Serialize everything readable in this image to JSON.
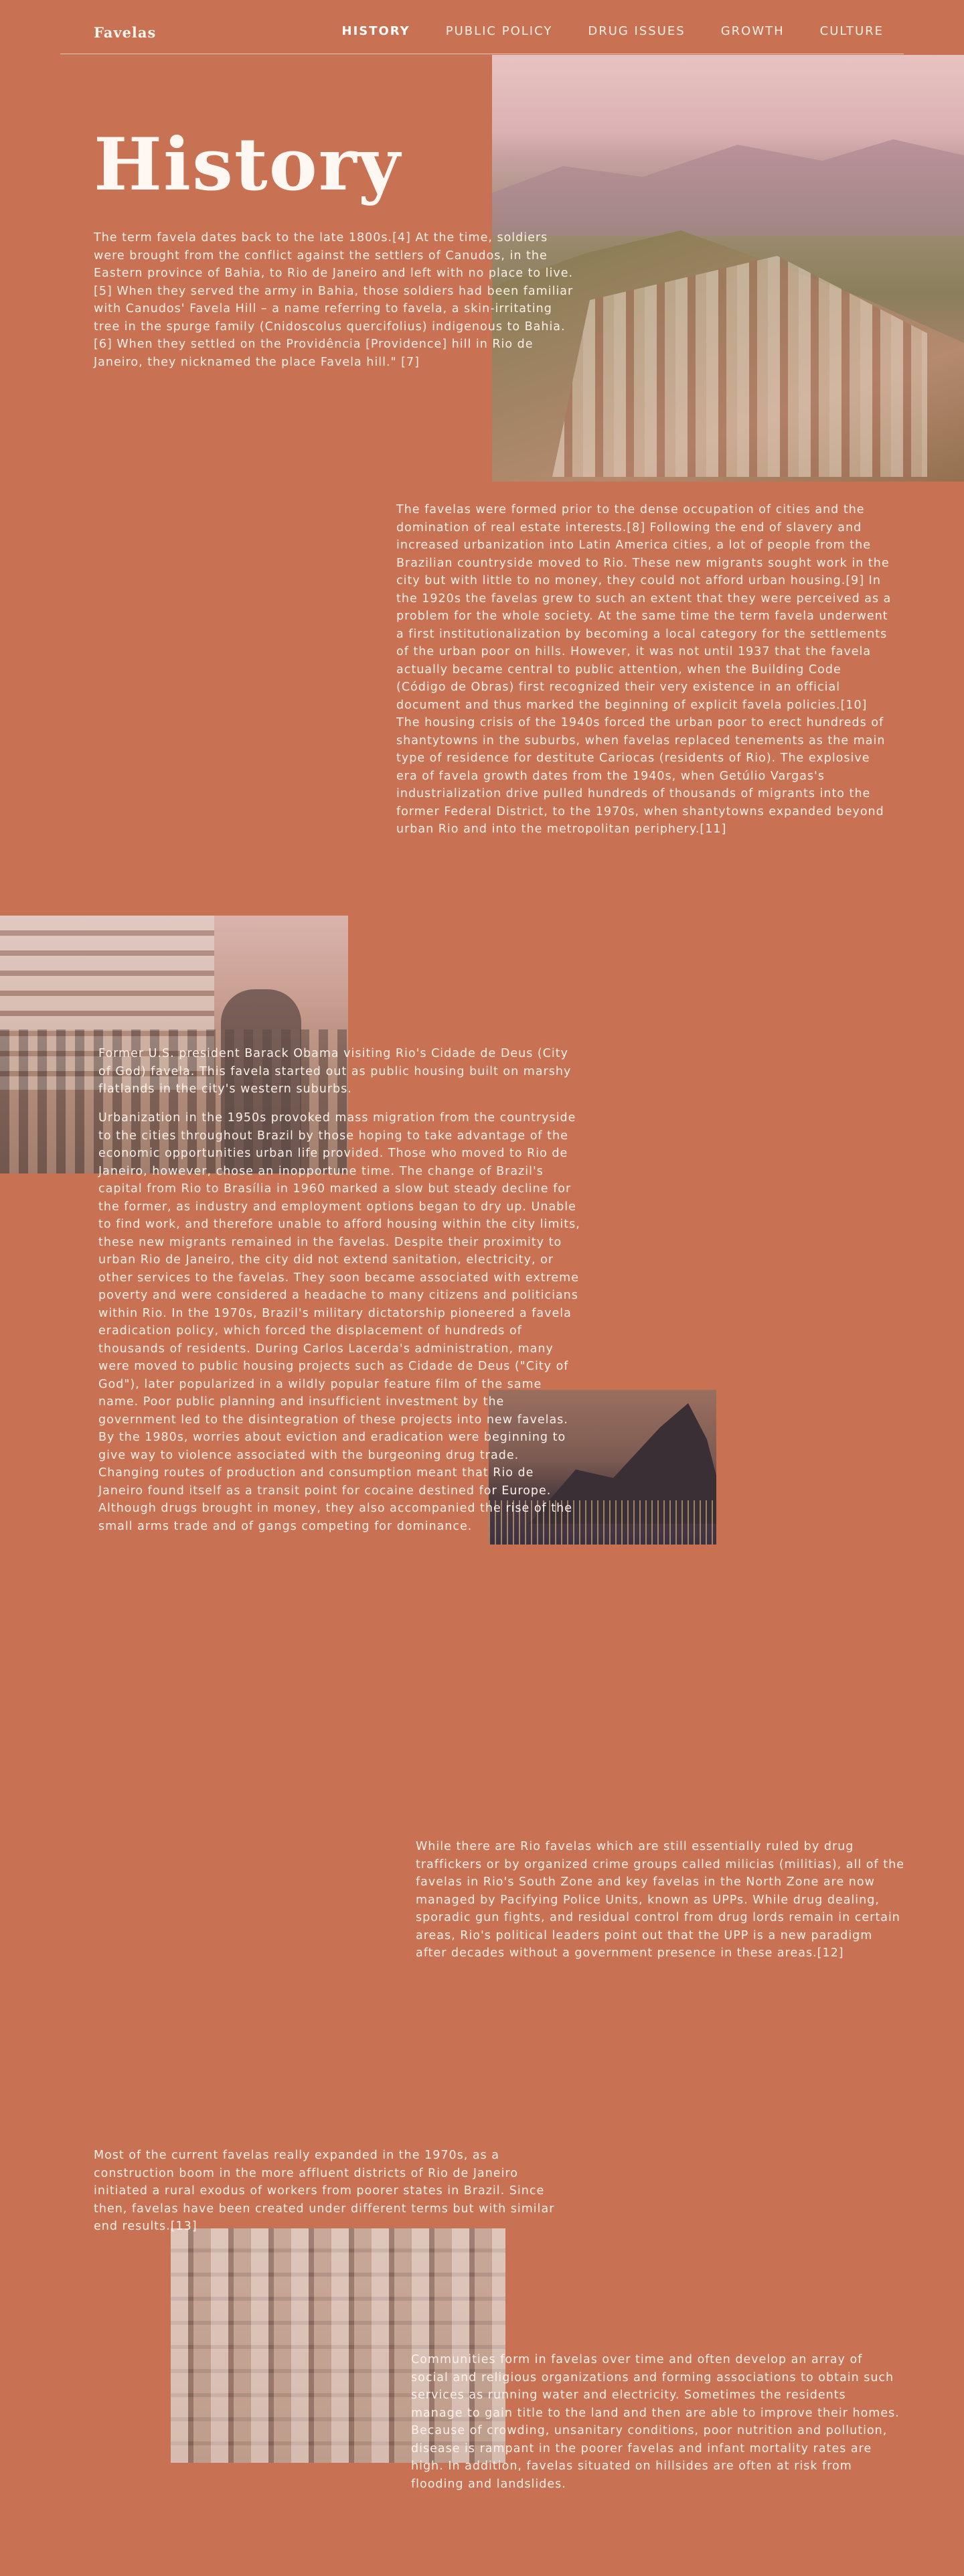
{
  "nav": {
    "brand": "Favelas",
    "links": [
      "HISTORY",
      "PUBLIC POLICY",
      "DRUG ISSUES",
      "GROWTH",
      "CULTURE"
    ],
    "active": "HISTORY"
  },
  "page": {
    "title": "History"
  },
  "content": {
    "p1": "The term favela dates back to the late 1800s.[4] At the time, soldiers were brought from the conflict against the settlers of Canudos, in the Eastern province of Bahia, to Rio de Janeiro and left with no place to live.[5] When they served the army in Bahia, those soldiers had been familiar with Canudos' Favela Hill – a name referring to favela, a skin-irritating tree in the spurge family (Cnidoscolus quercifolius) indigenous to Bahia.[6] When they settled on the Providência [Providence] hill in Rio de Janeiro, they nicknamed the place Favela hill.\" [7]",
    "p2": "The favelas were formed prior to the dense occupation of cities and the domination of real estate interests.[8] Following the end of slavery and increased urbanization into Latin America cities, a lot of people from the Brazilian countryside moved to Rio. These new migrants sought work in the city but with little to no money, they could not afford urban housing.[9] In the 1920s the favelas grew to such an extent that they were perceived as a problem for the whole society. At the same time the term favela underwent a first institutionalization by becoming a local category for the settlements of the urban poor on hills. However, it was not until 1937 that the favela actually became central to public attention, when the Building Code (Código de Obras) first recognized their very existence in an official document and thus marked the beginning of explicit favela policies.[10] The housing crisis of the 1940s forced the urban poor to erect hundreds of shantytowns in the suburbs, when favelas replaced tenements as the main type of residence for destitute Cariocas (residents of Rio). The explosive era of favela growth dates from the 1940s, when Getúlio Vargas's industrialization drive pulled hundreds of thousands of migrants into the former Federal District, to the 1970s, when shantytowns expanded beyond urban Rio and into the metropolitan periphery.[11]",
    "caption": "Former U.S. president Barack Obama visiting Rio's Cidade de Deus (City of God) favela. This favela started out as public housing built on marshy flatlands in the city's western suburbs.",
    "p3": "Urbanization in the 1950s provoked mass migration from the countryside to the cities throughout Brazil by those hoping to take advantage of the economic opportunities urban life provided. Those who moved to Rio de Janeiro, however, chose an inopportune time. The change of Brazil's capital from Rio to Brasília in 1960 marked a slow but steady decline for the former, as industry and employment options began to dry up. Unable to find work, and therefore unable to afford housing within the city limits, these new migrants remained in the favelas. Despite their proximity to urban Rio de Janeiro, the city did not extend sanitation, electricity, or other services to the favelas. They soon became associated with extreme poverty and were considered a headache to many citizens and politicians within Rio. In the 1970s, Brazil's military dictatorship pioneered a favela eradication policy, which forced the displacement of hundreds of thousands of residents. During Carlos Lacerda's administration, many were moved to public housing projects such as Cidade de Deus (\"City of God\"), later popularized in a wildly popular feature film of the same name. Poor public planning and insufficient investment by the government led to the disintegration of these projects into new favelas. By the 1980s, worries about eviction and eradication were beginning to give way to violence associated with the burgeoning drug trade. Changing routes of production and consumption meant that Rio de Janeiro found itself as a transit point for cocaine destined for Europe. Although drugs brought in money, they also accompanied the rise of the small arms trade and of gangs competing for dominance.",
    "p4": "While there are Rio favelas which are still essentially ruled by drug traffickers or by organized crime groups called milicias (militias), all of the favelas in Rio's South Zone and key favelas in the North Zone are now managed by Pacifying Police Units, known as UPPs. While drug dealing, sporadic gun fights, and residual control from drug lords remain in certain areas, Rio's political leaders point out that the UPP is a new paradigm after decades without a government presence in these areas.[12]",
    "p5": "Most of the current favelas really expanded in the 1970s, as a construction boom in the more affluent districts of Rio de Janeiro initiated a rural exodus of workers from poorer states in Brazil. Since then, favelas have been created under different terms but with similar end results.[13]",
    "p6": "Communities form in favelas over time and often develop an array of social and religious organizations and forming associations to obtain such services as running water and electricity. Sometimes the residents manage to gain title to the land and then are able to improve their homes. Because of crowding, unsanitary conditions, poor nutrition and pollution, disease is rampant in the poorer favelas and infant mortality rates are high. In addition, favelas situated on hillsides are often at risk from flooding and landslides."
  }
}
